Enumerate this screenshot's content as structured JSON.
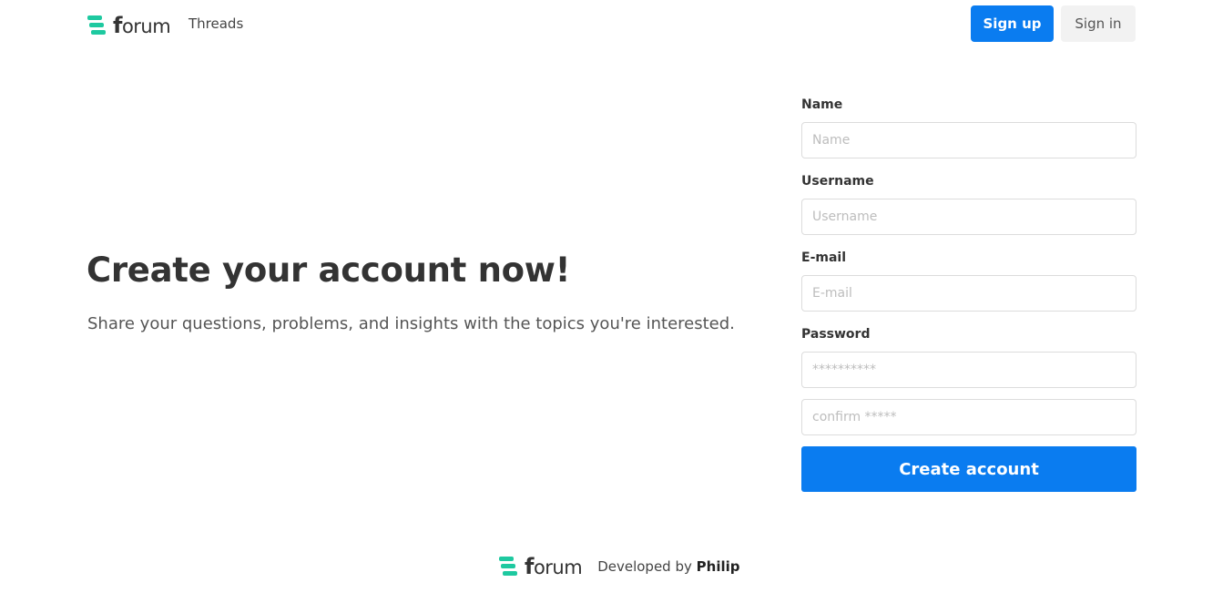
{
  "header": {
    "logo_f": "f",
    "logo_rest": "orum",
    "nav_threads": "Threads",
    "signup_label": "Sign up",
    "signin_label": "Sign in"
  },
  "hero": {
    "title": "Create your account now!",
    "subtitle": "Share your questions, problems, and insights with the topics you're interested."
  },
  "form": {
    "name_label": "Name",
    "name_placeholder": "Name",
    "username_label": "Username",
    "username_placeholder": "Username",
    "email_label": "E-mail",
    "email_placeholder": "E-mail",
    "password_label": "Password",
    "password_placeholder": "**********",
    "confirm_placeholder": "confirm *****",
    "submit_label": "Create account"
  },
  "footer": {
    "logo_f": "f",
    "logo_rest": "orum",
    "developed_by": "Developed by",
    "author": "Philip"
  },
  "colors": {
    "primary": "#0a7cf0",
    "logo_accent": "#1ec9a0"
  },
  "icons": {
    "logo": "stacked-layers-icon"
  }
}
